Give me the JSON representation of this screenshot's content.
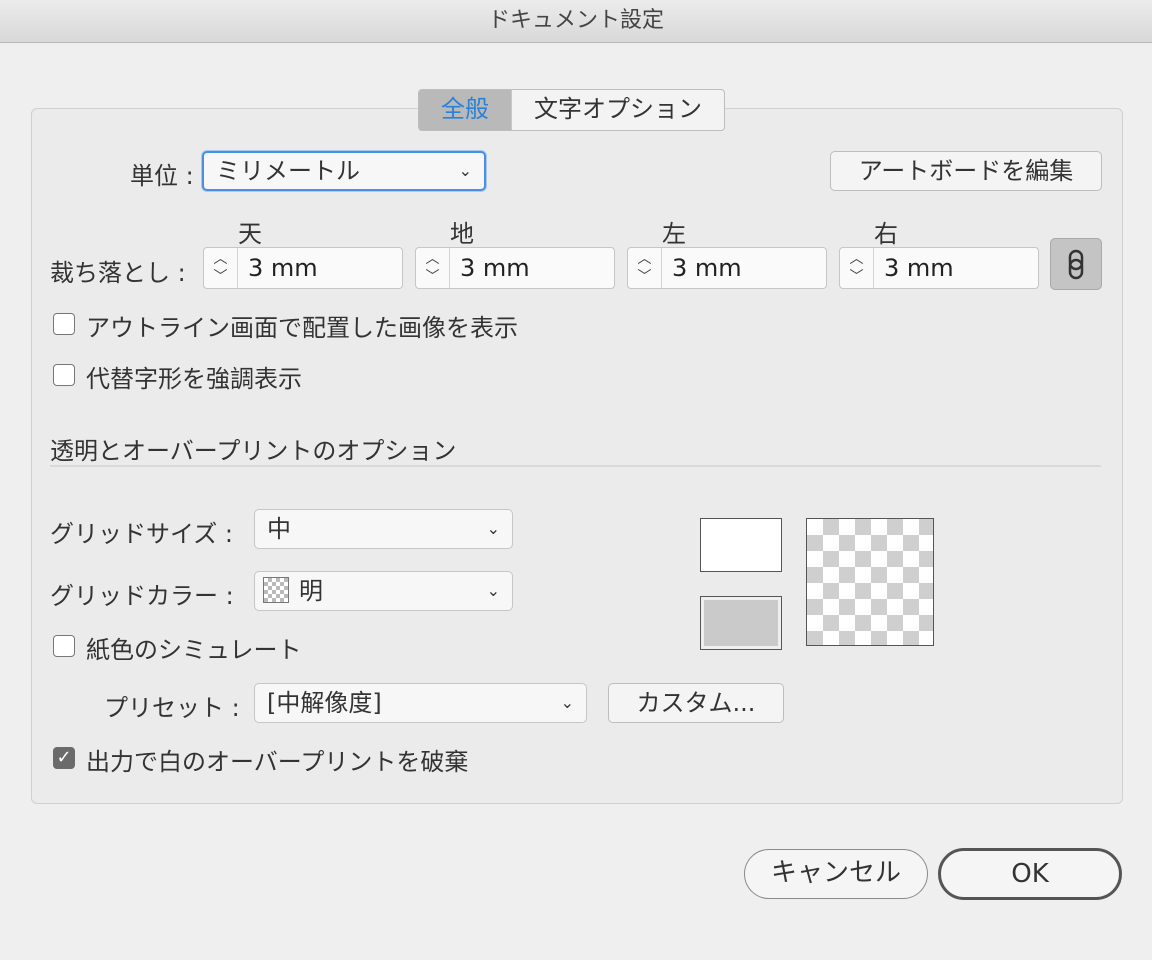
{
  "window": {
    "title": "ドキュメント設定"
  },
  "tabs": [
    {
      "label": "全般",
      "active": true
    },
    {
      "label": "文字オプション",
      "active": false
    }
  ],
  "units": {
    "label": "単位 :",
    "value": "ミリメートル"
  },
  "edit_artboards_label": "アートボードを編集",
  "bleed": {
    "label": "裁ち落とし :",
    "fields": [
      {
        "header": "天",
        "value": "3 mm"
      },
      {
        "header": "地",
        "value": "3 mm"
      },
      {
        "header": "左",
        "value": "3 mm"
      },
      {
        "header": "右",
        "value": "3 mm"
      }
    ],
    "link_icon": "chain-link-icon"
  },
  "checkboxes": {
    "show_images_outline": {
      "label": "アウトライン画面で配置した画像を表示",
      "checked": false
    },
    "highlight_glyphs": {
      "label": "代替字形を強調表示",
      "checked": false
    },
    "simulate_paper": {
      "label": "紙色のシミュレート",
      "checked": false
    },
    "discard_white_overprint": {
      "label": "出力で白のオーバープリントを破棄",
      "checked": true
    }
  },
  "transparency": {
    "section_title": "透明とオーバープリントのオプション",
    "grid_size": {
      "label": "グリッドサイズ :",
      "value": "中"
    },
    "grid_color": {
      "label": "グリッドカラー :",
      "value": "明"
    },
    "preset": {
      "label": "プリセット :",
      "value": "[中解像度]"
    },
    "custom_label": "カスタム..."
  },
  "buttons": {
    "cancel": "キャンセル",
    "ok": "OK"
  },
  "colors": {
    "accent": "#2a82d8",
    "focus": "#4a90e2",
    "background": "#efefef"
  }
}
